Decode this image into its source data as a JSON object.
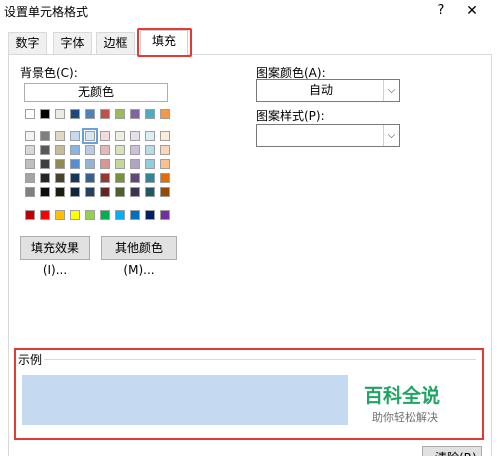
{
  "window": {
    "title": "设置单元格格式",
    "help": "?",
    "close": "✕"
  },
  "tabs": [
    {
      "label": "数字"
    },
    {
      "label": "字体"
    },
    {
      "label": "边框"
    },
    {
      "label": "填充"
    }
  ],
  "active_tab": "填充",
  "fill": {
    "background_label": "背景色(C):",
    "no_color_label": "无颜色",
    "selected_swatch": "light-blue",
    "fill_effects_label": "填充效果(I)...",
    "more_colors_label": "其他颜色(M)..."
  },
  "pattern": {
    "color_label": "图案颜色(A):",
    "color_value": "自动",
    "style_label": "图案样式(P):",
    "style_value": ""
  },
  "sample": {
    "label": "示例",
    "color": "#c5d9f1",
    "clear_label": "清除(R)"
  },
  "watermark": {
    "title": "百科全说",
    "subtitle": "助你轻松解决"
  },
  "palette": {
    "theme_row": [
      "#ffffff",
      "#000000",
      "#eeece1",
      "#1f497d",
      "#4f81bd",
      "#c0504d",
      "#9bbb59",
      "#8064a2",
      "#4bacc6",
      "#f79646"
    ],
    "tint_rows": [
      [
        "#f2f2f2",
        "#7f7f7f",
        "#ddd9c3",
        "#c6d9f0",
        "#dbe5f1",
        "#f2dcdb",
        "#ebf1dd",
        "#e5e0ec",
        "#dbeef3",
        "#fdeada"
      ],
      [
        "#d8d8d8",
        "#595959",
        "#c4bd97",
        "#8db3e2",
        "#b8cce4",
        "#e5b9b7",
        "#d7e3bc",
        "#ccc1d9",
        "#b7dde8",
        "#fbd5b5"
      ],
      [
        "#bfbfbf",
        "#3f3f3f",
        "#938953",
        "#548dd4",
        "#95b3d7",
        "#d99694",
        "#c3d69b",
        "#b2a2c7",
        "#92cddc",
        "#fac08f"
      ],
      [
        "#a5a5a5",
        "#262626",
        "#494429",
        "#17365d",
        "#366092",
        "#953734",
        "#76923c",
        "#5f497a",
        "#31859b",
        "#e36c09"
      ],
      [
        "#7f7f7f",
        "#0c0c0c",
        "#1d1b10",
        "#0f243e",
        "#244061",
        "#632423",
        "#4f6128",
        "#3f3151",
        "#205867",
        "#974806"
      ]
    ],
    "standard_row": [
      "#c00000",
      "#ff0000",
      "#ffc000",
      "#ffff00",
      "#92d050",
      "#00b050",
      "#00b0f0",
      "#0070c0",
      "#002060",
      "#7030a0"
    ]
  }
}
